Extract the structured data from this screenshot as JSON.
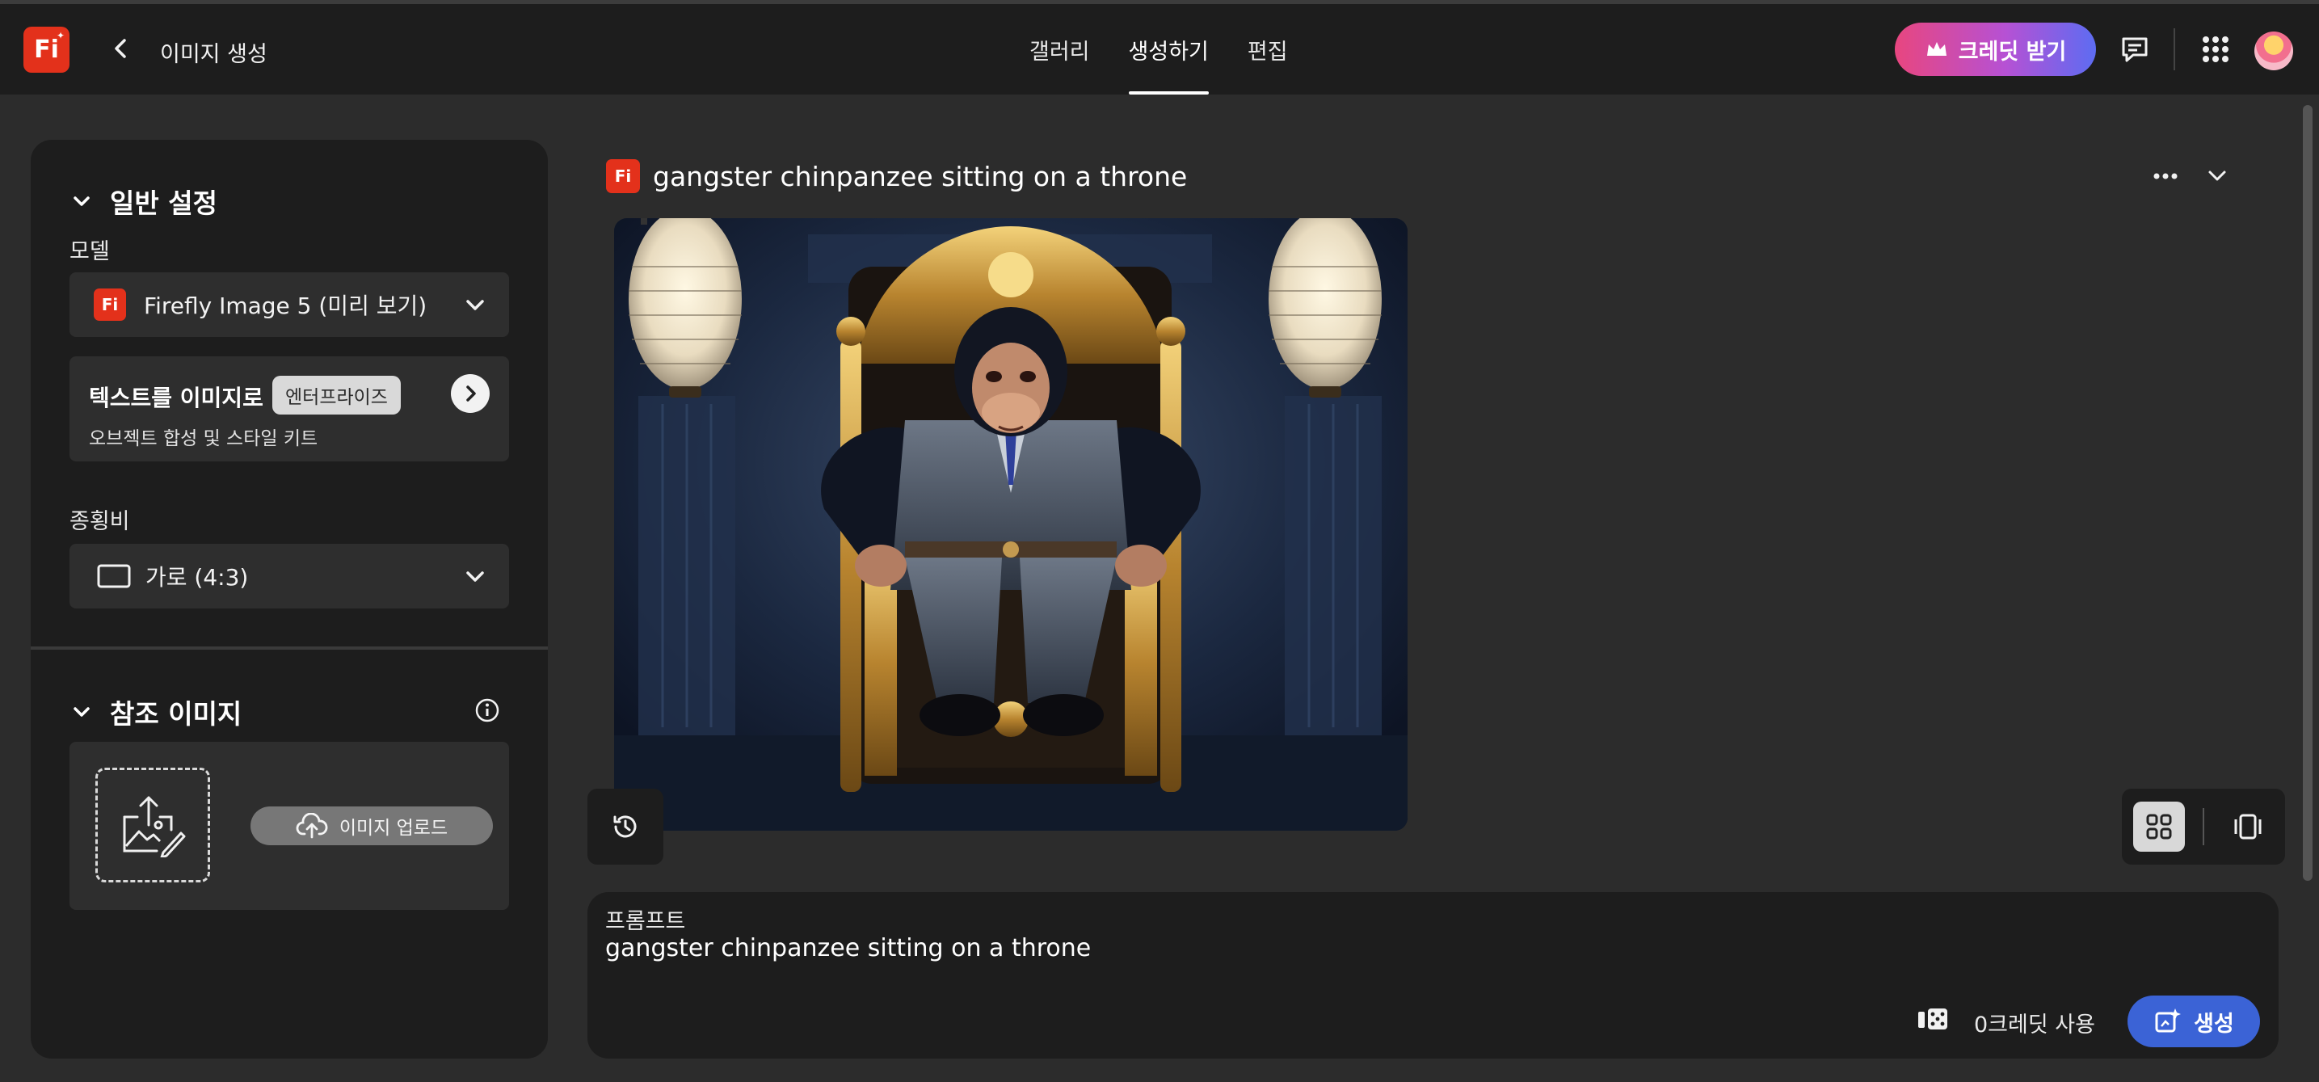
{
  "header": {
    "logo_text": "Fi",
    "title": "이미지 생성",
    "tabs": [
      {
        "label": "갤러리",
        "active": false
      },
      {
        "label": "생성하기",
        "active": true
      },
      {
        "label": "편집",
        "active": false
      }
    ],
    "credit_button": "크레딧 받기",
    "icons": [
      "back-icon",
      "chat-icon",
      "apps-grid-icon",
      "avatar"
    ]
  },
  "sidebar": {
    "general": {
      "heading": "일반 설정",
      "model_label": "모델",
      "model_value": "Firefly Image 5 (미리 보기)",
      "t2i_title": "텍스트를 이미지로",
      "t2i_badge": "엔터프라이즈",
      "t2i_sub": "오브젝트 합성 및 스타일 키트",
      "aspect_label": "종횡비",
      "aspect_value": "가로 (4:3)"
    },
    "reference": {
      "heading": "참조 이미지",
      "upload_label": "이미지 업로드"
    }
  },
  "main": {
    "generation_title": "gangster chinpanzee sitting on a throne",
    "image_alt": "Chimpanzee in a grey suit sitting on a gold throne between two lanterns"
  },
  "prompt": {
    "label": "프롬프트",
    "text": "gangster chinpanzee sitting on a throne",
    "cost": "0크레딧 사용",
    "generate_label": "생성"
  },
  "colors": {
    "brand_red": "#e3311b",
    "generate_blue": "#3b63d6",
    "header_bg": "#1d1d1d",
    "page_bg": "#2c2c2c"
  }
}
